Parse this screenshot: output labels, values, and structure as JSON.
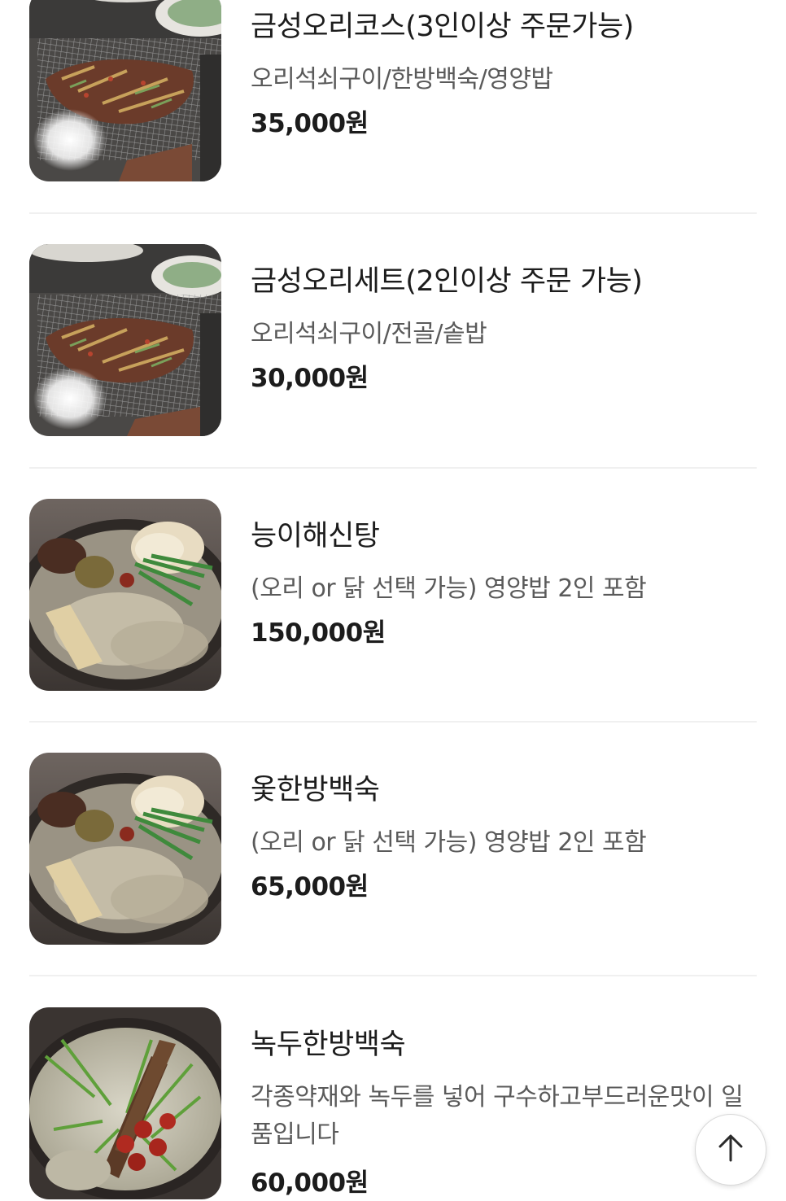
{
  "menu": {
    "items": [
      {
        "name": "금성오리코스(3인이상 주문가능)",
        "description": "오리석쇠구이/한방백숙/영양밥",
        "price": "35,000원",
        "image": "grilled-duck-photo"
      },
      {
        "name": "금성오리세트(2인이상 주문 가능)",
        "description": "오리석쇠구이/전골/솥밥",
        "price": "30,000원",
        "image": "grilled-duck-photo"
      },
      {
        "name": "능이해신탕",
        "description": "(오리 or 닭 선택 가능) 영양밥 2인 포함",
        "price": "150,000원",
        "image": "herbal-duck-soup-photo"
      },
      {
        "name": "옻한방백숙",
        "description": "(오리 or 닭 선택 가능) 영양밥 2인 포함",
        "price": "65,000원",
        "image": "herbal-duck-soup-photo"
      },
      {
        "name": "녹두한방백숙",
        "description": "각종약재와 녹두를 넣어 구수하고부드러운맛이 일품입니다",
        "price": "60,000원",
        "image": "mungbean-chicken-soup-photo"
      }
    ]
  },
  "scroll_top": {
    "icon": "arrow-up-icon"
  },
  "colors": {
    "text_primary": "#1c1c1c",
    "text_secondary": "#5a5a5a",
    "divider": "#f0f0f0"
  }
}
